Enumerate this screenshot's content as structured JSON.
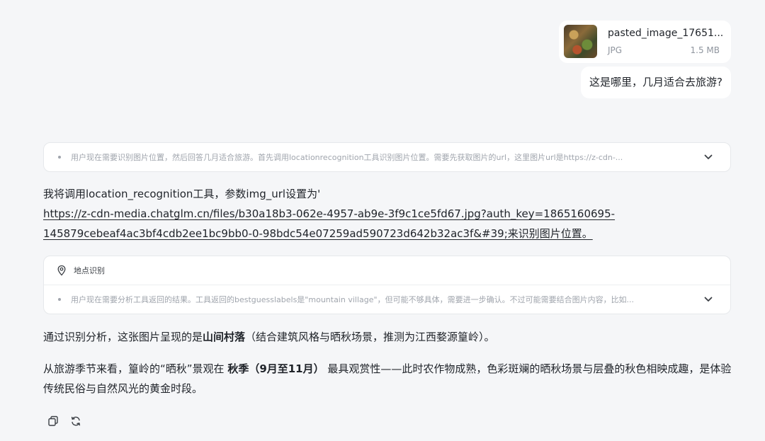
{
  "attachment": {
    "name": "pasted_image_17651...",
    "type": "JPG",
    "size": "1.5 MB"
  },
  "user_message": "这是哪里，几月适合去旅游?",
  "thinking_1": "用户现在需要识别图片位置，然后回答几月适合旅游。首先调用locationrecognition工具识别图片位置。需要先获取图片的url，这里图片url是https://z-cdn-...",
  "assistant_intro": "我将调用location_recognition工具，参数img_url设置为'",
  "assistant_link_line1": "https://z-cdn-media.chatglm.cn/files/b30a18b3-062e-4957-ab9e-3f9c1ce5fd67.jpg?auth_key=1865160695-",
  "assistant_link_line2": "145879cebeaf4ac3bf4cdb2ee1bc9bb0-0-98bdc54e07259ad590723d642b32ac3f&#39;来识别图片位置。",
  "tool": {
    "title": "地点识别",
    "thinking": "用户现在需要分析工具返回的结果。工具返回的bestguesslabels是\"mountain village\"，但可能不够具体，需要进一步确认。不过可能需要结合图片内容，比如..."
  },
  "answer_1": {
    "pre": "通过识别分析，这张图片呈现的是",
    "bold": "山间村落",
    "post": "（结合建筑风格与晒秋场景，推测为江西婺源篁岭）。"
  },
  "answer_2": {
    "pre": "从旅游季节来看，篁岭的“晒秋”景观在 ",
    "bold": "秋季（9月至11月）",
    "post": " 最具观赏性——此时农作物成熟，色彩斑斓的晒秋场景与层叠的秋色相映成趣，是体验传统民俗与自然风光的黄金时段。"
  }
}
